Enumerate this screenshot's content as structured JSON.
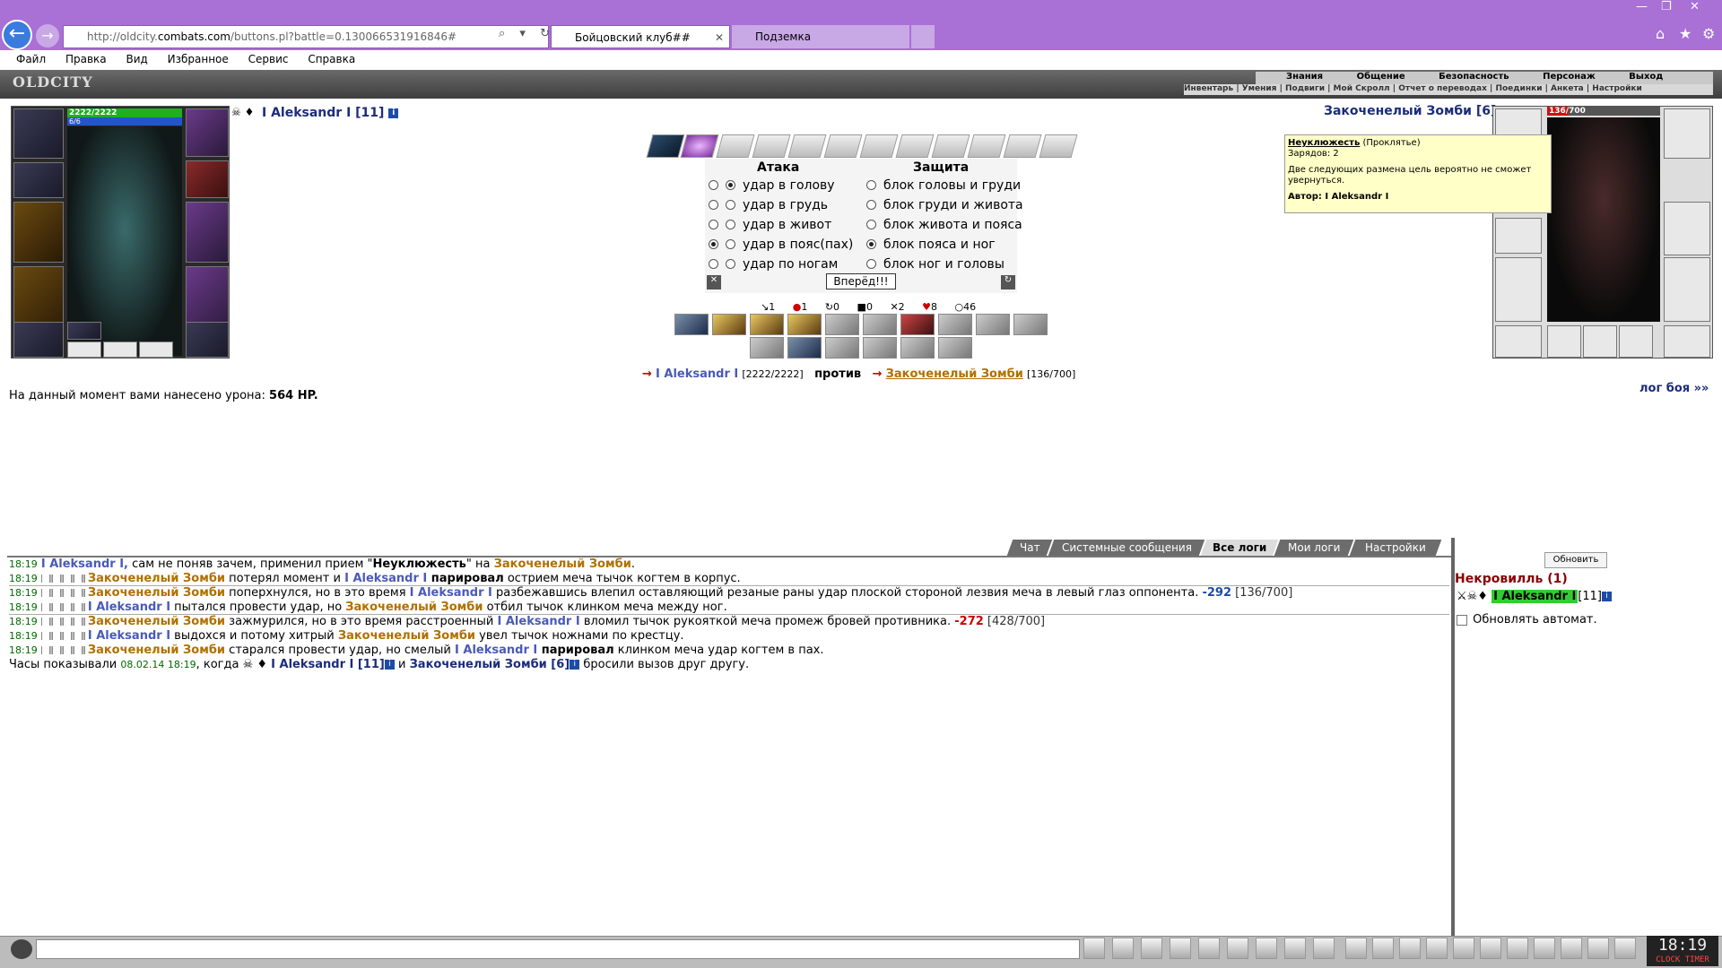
{
  "browser": {
    "url_prefix": "http://oldcity.",
    "url_domain": "combats.com",
    "url_rest": "/buttons.pl?battle=0.130066531916846#",
    "tabs": [
      {
        "label": "Бойцовский клуб##"
      },
      {
        "label": "Подземка"
      }
    ],
    "menu": [
      "Файл",
      "Правка",
      "Вид",
      "Избранное",
      "Сервис",
      "Справка"
    ]
  },
  "game": {
    "logo": "OLDCITY",
    "topnav": [
      "Знания",
      "Общение",
      "Безопасность",
      "Персонаж",
      "Выход"
    ],
    "subnav": "Инвентарь | Умения | Подвиги | Мой Скролл | Отчет о переводах | Поединки | Анкета | Настройки"
  },
  "player": {
    "name": "I Aleksandr I [11]",
    "hp": "2222/2222",
    "mana": "6/6"
  },
  "enemy": {
    "name": "Закоченелый Зомби [6]",
    "hp": "136/700",
    "hp_fraction": 0.194
  },
  "tooltip": {
    "title": "Неуклюжесть",
    "type": "(Проклятье)",
    "charges": "Зарядов: 2",
    "desc": "Две следующих размена цель вероятно не сможет увернуться.",
    "author": "Автор: I Aleksandr I"
  },
  "battle": {
    "attack_header": "Атака",
    "defense_header": "Защита",
    "attacks": [
      "удар в голову",
      "удар в грудь",
      "удар в живот",
      "удар в пояс(пах)",
      "удар по ногам"
    ],
    "attack_selected": 0,
    "attack_alt_selected": 3,
    "blocks": [
      "блок головы и груди",
      "блок груди и живота",
      "блок живота и пояса",
      "блок пояса и ног",
      "блок ног и головы"
    ],
    "block_selected": 3,
    "go_button": "Вперёд!!!",
    "stats": [
      "1",
      "1",
      "0",
      "0",
      "2",
      "8",
      "46"
    ],
    "vs_player": "I Aleksandr I",
    "vs_player_hp": "[2222/2222]",
    "vs_word": "против",
    "vs_enemy": "Закоченелый Зомби",
    "vs_enemy_hp": "[136/700]",
    "damage_text": "На данный момент вами нанесено урона:",
    "damage_value": "564 HP.",
    "log_link": "лог боя »»"
  },
  "chat": {
    "tabs": [
      "Чат",
      "Системные сообщения",
      "Все логи",
      "Мои логи",
      "Настройки"
    ],
    "active_tab": 2,
    "lines": [
      {
        "t": "18:19",
        "a": "I Aleksandr I,",
        "b": " сам не поняв зачем, применил прием \"",
        "c": "Неуклюжесть",
        "d": "\" на ",
        "e": "Закоченелый Зомби",
        "f": "."
      },
      {
        "t": "18:19",
        "a": "Закоченелый Зомби",
        "b": " потерял момент и ",
        "c": "I Aleksandr I",
        "d": " парировал",
        "e": " острием меча тычок когтем в корпус.",
        "f": ""
      },
      {
        "t": "18:19",
        "a": "Закоченелый Зомби",
        "b": " поперхнулся, но в это время ",
        "c": "I Aleksandr I",
        "d": " разбежавшись влепил оставляющий резаные раны удар плоской стороной лезвия меча в левый глаз оппонента. ",
        "e": "-292",
        "f": " [136/700]"
      },
      {
        "t": "18:19",
        "a": "I Aleksandr I",
        "b": " пытался провести удар, но ",
        "c": "Закоченелый Зомби",
        "d": " отбил тычок клинком меча между ног.",
        "e": "",
        "f": ""
      },
      {
        "t": "18:19",
        "a": "Закоченелый Зомби",
        "b": " зажмурился, но в это время расстроенный ",
        "c": "I Aleksandr I",
        "d": " вломил тычок рукояткой меча промеж бровей противника. ",
        "e": "-272",
        "f": " [428/700]"
      },
      {
        "t": "18:19",
        "a": "I Aleksandr I",
        "b": " выдохся и потому хитрый ",
        "c": "Закоченелый Зомби",
        "d": " увел тычок ножнами по крестцу.",
        "e": "",
        "f": ""
      },
      {
        "t": "18:19",
        "a": "Закоченелый Зомби",
        "b": " старался провести удар, но смелый ",
        "c": "I Aleksandr I",
        "d": " парировал",
        "e": " клинком меча удар когтем в пах.",
        "f": ""
      }
    ],
    "final_prefix": "Часы показывали ",
    "final_time": "08.02.14 18:19",
    "final_mid": ", когда ",
    "final_p": "I Aleksandr I [11]",
    "final_and": " и ",
    "final_e": "Закоченелый Зомби [6]",
    "final_end": " бросили вызов друг другу."
  },
  "online": {
    "refresh": "Обновить",
    "location": "Некровилль (1)",
    "user": "I Aleksandr I",
    "user_level": "[11]",
    "auto_refresh": "Обновлять автомат."
  },
  "clock": {
    "time": "18:19",
    "brand": "CLOCK TIMER"
  },
  "colors": {
    "browser_chrome": "#a970d6",
    "hp_green": "#1fb01f",
    "enemy_hp_red": "#c81414",
    "link_blue": "#1c2c7c",
    "enemy_gold": "#b07000"
  }
}
